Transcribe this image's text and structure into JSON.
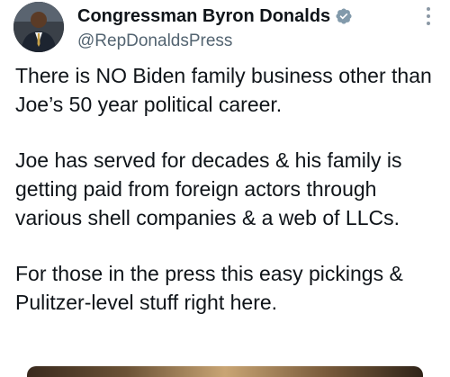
{
  "tweet": {
    "author": {
      "display_name": "Congressman Byron Donalds",
      "handle": "@RepDonaldsPress",
      "verified": true,
      "avatar_icon": "profile-photo"
    },
    "more_icon": "more-vertical-icon",
    "paragraphs": [
      "There is NO Biden family business other than Joe’s 50 year political career.",
      "Joe has served for decades & his family is getting paid from foreign actors through various shell companies & a web of LLCs.",
      "For those in the press this easy pickings & Pulitzer-level stuff right here."
    ]
  },
  "colors": {
    "text": "#0f1419",
    "secondary_text": "#536471",
    "verified_badge": "#829aab",
    "background": "#ffffff"
  }
}
